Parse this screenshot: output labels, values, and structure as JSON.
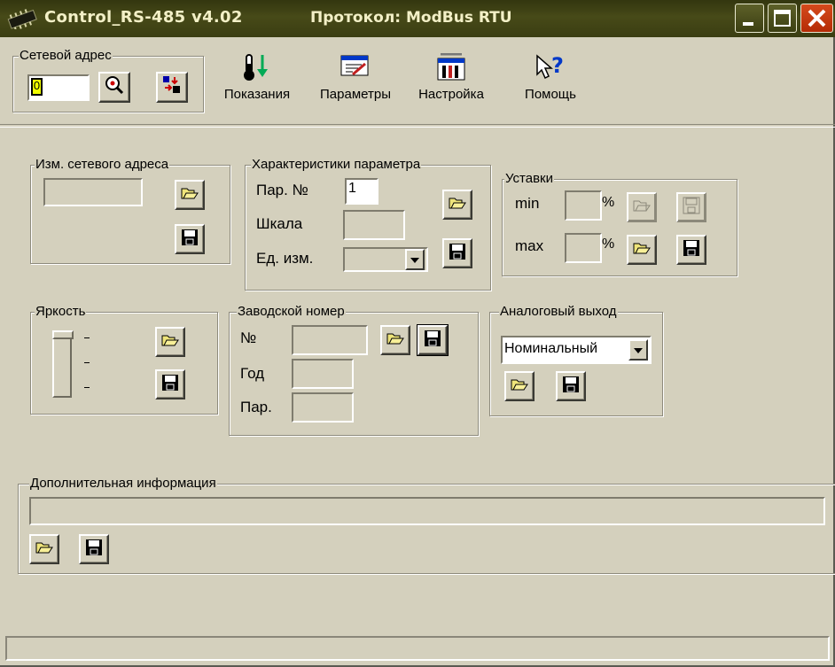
{
  "window": {
    "title": "Control_RS-485 v4.02",
    "protocol": "Протокол: ModBus RTU",
    "buttons": [
      "minimize-icon",
      "maximize-icon",
      "close-icon"
    ]
  },
  "network": {
    "legend": "Сетевой адрес",
    "address_value": "0"
  },
  "toolbar": {
    "readings_label": "Показания",
    "params_label": "Параметры",
    "settings_label": "Настройка",
    "help_label": "Помощь"
  },
  "change_address": {
    "legend": "Изм. сетевого адреса",
    "value": ""
  },
  "param_chars": {
    "legend": "Характеристики параметра",
    "param_no_label": "Пар. №",
    "param_no_value": "1",
    "scale_label": "Шкала",
    "scale_value": "",
    "unit_label": "Ед. изм.",
    "unit_value": ""
  },
  "setpoints": {
    "legend": "Уставки",
    "min_label": "min",
    "min_value": "",
    "max_label": "max",
    "max_value": "",
    "percent": "%"
  },
  "brightness": {
    "legend": "Яркость",
    "level_fraction": 1.0
  },
  "serial": {
    "legend": "Заводской номер",
    "no_label": "№",
    "no_value": "",
    "year_label": "Год",
    "year_value": "",
    "batch_label": "Пар.",
    "batch_value": ""
  },
  "analog_out": {
    "legend": "Аналоговый выход",
    "selected": "Номинальный"
  },
  "extra_info": {
    "legend": "Дополнительная информация",
    "value": ""
  },
  "colors": {
    "titlebar": "#3d4013",
    "window_bg": "#d4d0bd",
    "close_button": "#c23a0e",
    "title_text": "#f3f0c7"
  }
}
